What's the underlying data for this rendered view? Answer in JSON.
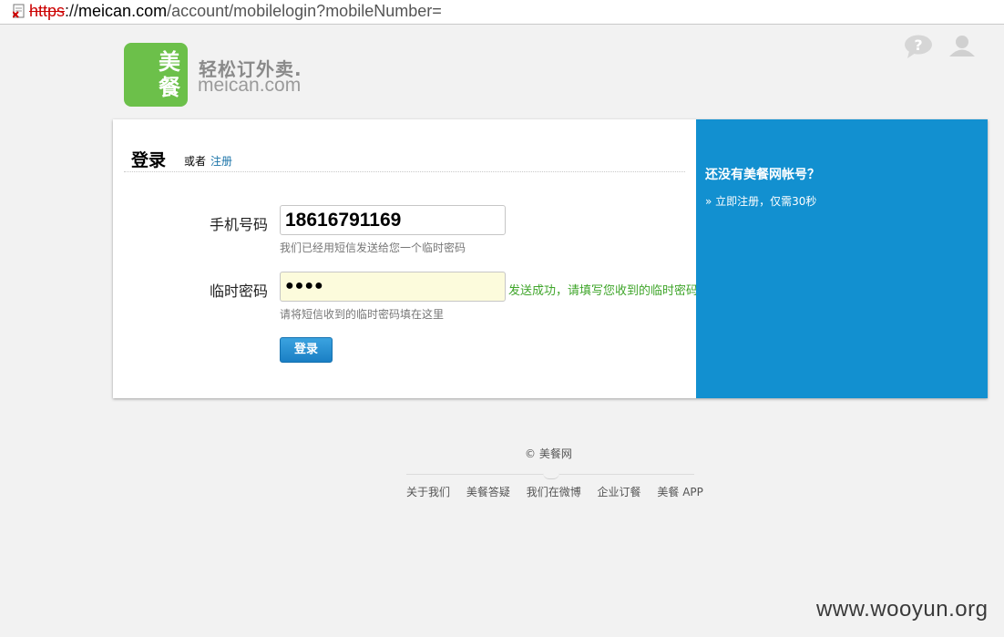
{
  "browser": {
    "url_scheme": "https",
    "url_sep": "://",
    "url_host": "meican.com",
    "url_path": "/account/mobilelogin?mobileNumber="
  },
  "header": {
    "logo_char_1": "美",
    "logo_char_2": "餐",
    "slogan": "轻松订外卖.",
    "domain": "meican.com",
    "logo_color": "#6cc04a"
  },
  "login": {
    "title": "登录",
    "or_text": "或者",
    "register_link": "注册",
    "phone_label": "手机号码",
    "phone_value": "18616791169",
    "phone_hint": "我们已经用短信发送给您一个临时密码",
    "code_label": "临时密码",
    "code_value": "●●●●",
    "code_success": "发送成功，请填写您收到的临时密码",
    "code_hint": "请将短信收到的临时密码填在这里",
    "submit_label": "登录"
  },
  "sidebar": {
    "title": "还没有美餐网帐号？",
    "link": "» 立即注册，仅需30秒",
    "color": "#1290d0"
  },
  "footer": {
    "copyright": "© 美餐网",
    "links": [
      "关于我们",
      "美餐答疑",
      "我们在微博",
      "企业订餐",
      "美餐 APP"
    ]
  },
  "watermark": "www.wooyun.org",
  "icons": {
    "help": "help-icon",
    "user": "user-icon",
    "page": "page-icon"
  }
}
